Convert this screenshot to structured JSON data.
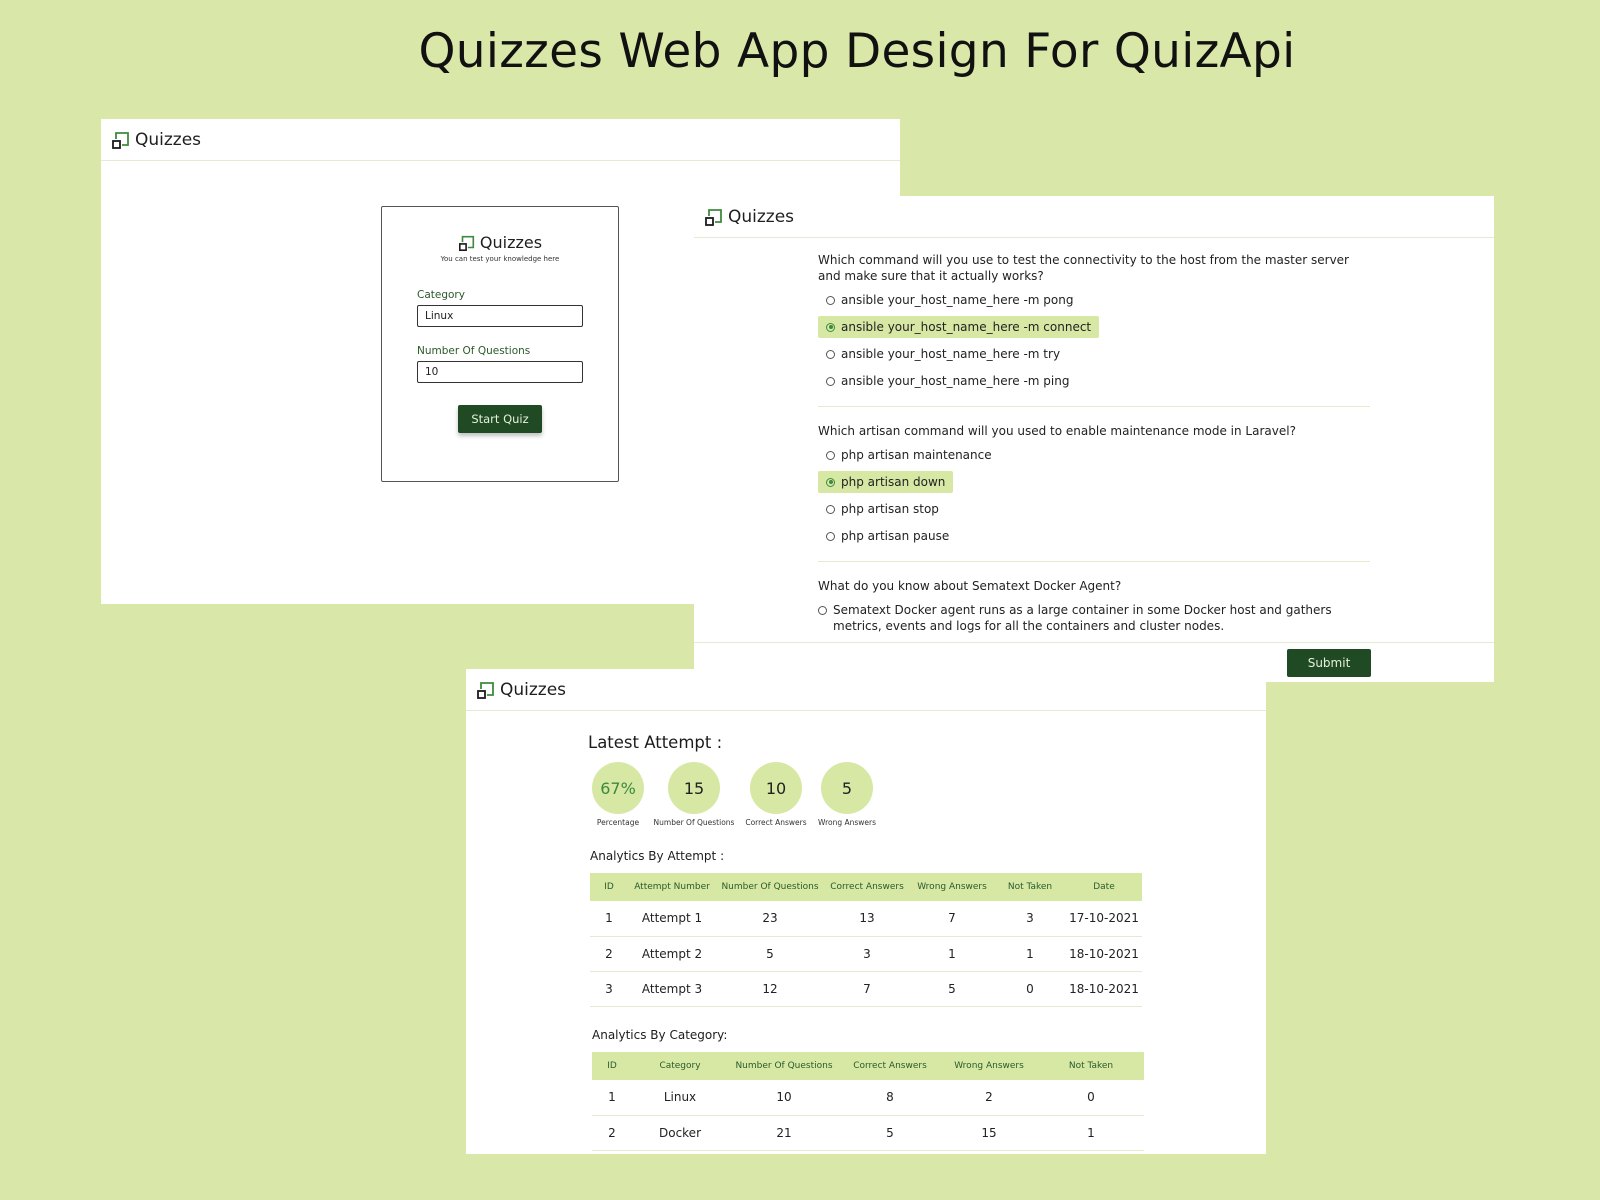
{
  "headline": "Quizzes Web App Design For QuizApi",
  "brand": "Quizzes",
  "accent_color": "#1f4a24",
  "highlight_color": "#d6e8a4",
  "background_color": "#d9e8a8",
  "start_screen": {
    "card_title": "Quizzes",
    "card_subtitle": "You can test your knowledge here",
    "category_label": "Category",
    "category_value": "Linux",
    "questions_label": "Number Of Questions",
    "questions_value": "10",
    "start_button": "Start Quiz"
  },
  "quiz": {
    "questions": [
      {
        "text": "Which command will you use to test the connectivity to the host from the master server and make sure that it actually works?",
        "options": [
          {
            "label": "ansible your_host_name_here -m pong",
            "selected": false
          },
          {
            "label": "ansible your_host_name_here -m connect",
            "selected": true
          },
          {
            "label": "ansible your_host_name_here -m try",
            "selected": false
          },
          {
            "label": "ansible your_host_name_here -m ping",
            "selected": false
          }
        ]
      },
      {
        "text": "Which artisan command will you used to enable maintenance mode in Laravel?",
        "options": [
          {
            "label": "php artisan maintenance",
            "selected": false
          },
          {
            "label": "php artisan down",
            "selected": true
          },
          {
            "label": "php artisan stop",
            "selected": false
          },
          {
            "label": "php artisan pause",
            "selected": false
          }
        ]
      },
      {
        "text": "What do you know about Sematext Docker Agent?",
        "options": [
          {
            "label": "Sematext Docker agent runs as a large container in some Docker host and gathers metrics, events and logs for all the containers and cluster nodes.",
            "selected": false
          }
        ]
      }
    ],
    "submit_button": "Submit"
  },
  "analytics": {
    "latest_title": "Latest Attempt :",
    "stats": [
      {
        "value": "67%",
        "label": "Percentage"
      },
      {
        "value": "15",
        "label": "Number Of Questions"
      },
      {
        "value": "10",
        "label": "Correct Answers"
      },
      {
        "value": "5",
        "label": "Wrong Answers"
      }
    ],
    "by_attempt_title": "Analytics By Attempt :",
    "by_attempt_headers": [
      "ID",
      "Attempt Number",
      "Number Of Questions",
      "Correct Answers",
      "Wrong Answers",
      "Not Taken",
      "Date"
    ],
    "by_attempt_rows": [
      [
        "1",
        "Attempt 1",
        "23",
        "13",
        "7",
        "3",
        "17-10-2021"
      ],
      [
        "2",
        "Attempt 2",
        "5",
        "3",
        "1",
        "1",
        "18-10-2021"
      ],
      [
        "3",
        "Attempt 3",
        "12",
        "7",
        "5",
        "0",
        "18-10-2021"
      ]
    ],
    "by_category_title": "Analytics By Category:",
    "by_category_headers": [
      "ID",
      "Category",
      "Number Of Questions",
      "Correct Answers",
      "Wrong Answers",
      "Not Taken"
    ],
    "by_category_rows": [
      [
        "1",
        "Linux",
        "10",
        "8",
        "2",
        "0"
      ],
      [
        "2",
        "Docker",
        "21",
        "5",
        "15",
        "1"
      ]
    ]
  }
}
